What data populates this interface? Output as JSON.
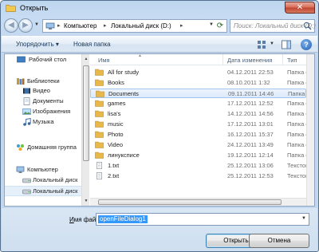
{
  "window": {
    "title": "Открыть",
    "close_glyph": "✕"
  },
  "navigation": {
    "back_glyph": "◀",
    "forward_glyph": "▶",
    "breadcrumbs": [
      "Компьютер",
      "Локальный диск (D:)"
    ],
    "separator": "▸",
    "search_placeholder": "Поиск: Локальный диск (D:)"
  },
  "toolbar": {
    "organize_label": "Упорядочить ▾",
    "new_folder_label": "Новая папка",
    "help_label": "?"
  },
  "nav_pane": {
    "items": [
      {
        "label": "Рабочий стол",
        "icon": "desktop-icon"
      },
      {
        "label": "Библиотеки",
        "icon": "libraries-icon"
      },
      {
        "label": "Видео",
        "icon": "video-icon"
      },
      {
        "label": "Документы",
        "icon": "documents-icon"
      },
      {
        "label": "Изображения",
        "icon": "pictures-icon"
      },
      {
        "label": "Музыка",
        "icon": "music-icon"
      },
      {
        "label": "Домашняя группа",
        "icon": "homegroup-icon"
      },
      {
        "label": "Компьютер",
        "icon": "computer-icon"
      },
      {
        "label": "Локальный диск",
        "icon": "drive-icon"
      },
      {
        "label": "Локальный диск",
        "icon": "drive-icon"
      }
    ]
  },
  "file_list": {
    "columns": {
      "name": "Имя",
      "date": "Дата изменения",
      "type": "Тип"
    },
    "rows": [
      {
        "name": "All for study",
        "date": "04.12.2011 22:53",
        "type": "Папка с фай",
        "kind": "folder"
      },
      {
        "name": "Books",
        "date": "08.10.2011 1:32",
        "type": "Папка с фай",
        "kind": "folder"
      },
      {
        "name": "Documents",
        "date": "09.11.2011 14:46",
        "type": "Папка с фай",
        "kind": "folder",
        "selected": true
      },
      {
        "name": "games",
        "date": "17.12.2011 12:52",
        "type": "Папка с фай",
        "kind": "folder"
      },
      {
        "name": "lisa's",
        "date": "14.12.2011 14:56",
        "type": "Папка с фай",
        "kind": "folder"
      },
      {
        "name": "music",
        "date": "17.12.2011 13:01",
        "type": "Папка с фай",
        "kind": "folder"
      },
      {
        "name": "Photo",
        "date": "16.12.2011 15:37",
        "type": "Папка с фай",
        "kind": "folder"
      },
      {
        "name": "Video",
        "date": "24.12.2011 13:49",
        "type": "Папка с фай",
        "kind": "folder"
      },
      {
        "name": "линуксписе",
        "date": "19.12.2011 12:14",
        "type": "Папка с фай",
        "kind": "folder"
      },
      {
        "name": "1.txt",
        "date": "25.12.2011 13:06",
        "type": "Текстовый д",
        "kind": "txt"
      },
      {
        "name": "2.txt",
        "date": "25.12.2011 12:53",
        "type": "Текстовый д",
        "kind": "txt"
      }
    ]
  },
  "footer": {
    "filename_label_underlined": "И",
    "filename_label_rest": "мя файла:",
    "filename_value": "openFileDialog1",
    "open_button": "Открыть",
    "cancel_button": "Отмена"
  },
  "colors": {
    "selection": "#3399ff",
    "folder": "#e8b94a",
    "accent": "#1e395b"
  }
}
